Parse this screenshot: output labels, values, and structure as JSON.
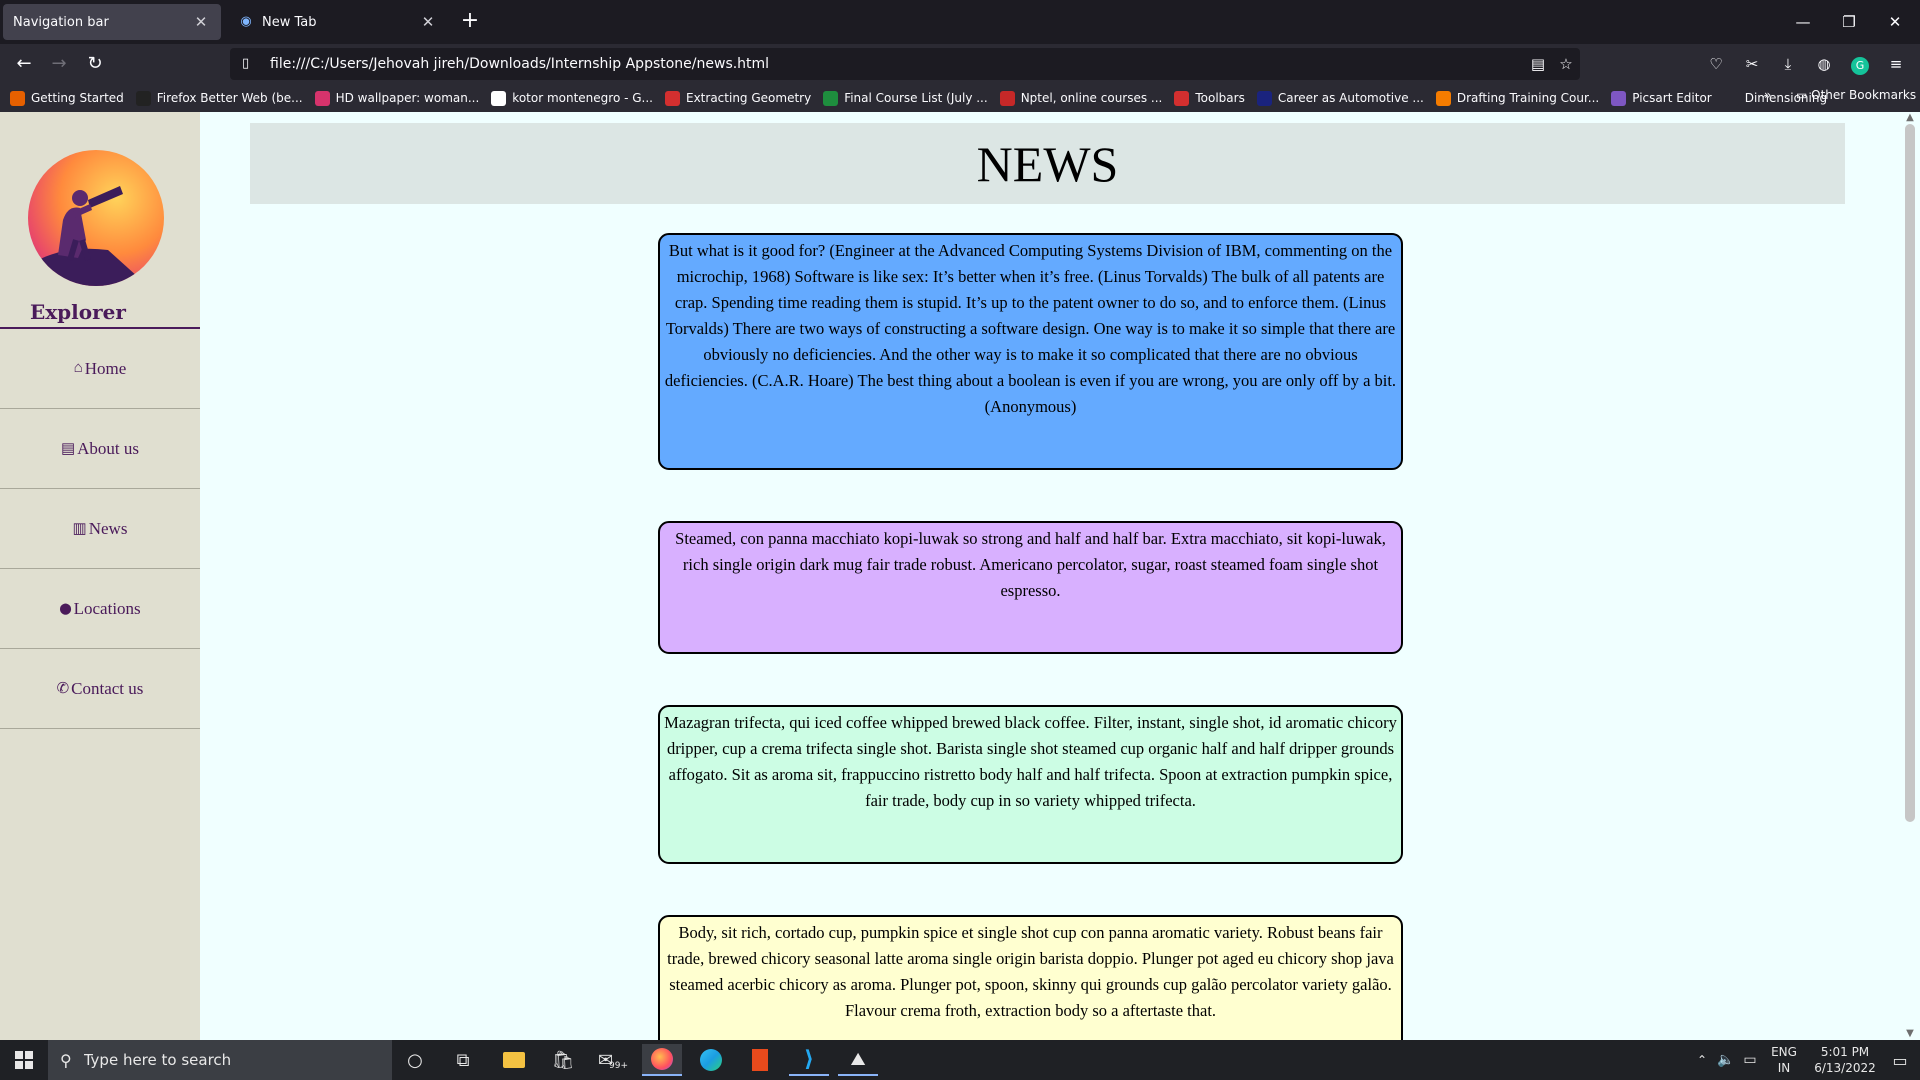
{
  "browser": {
    "tabs": [
      {
        "title": "Navigation bar",
        "active": true
      },
      {
        "title": "New Tab",
        "active": false
      }
    ],
    "url": "file:///C:/Users/Jehovah jireh/Downloads/Internship Appstone/news.html",
    "bookmarks": [
      {
        "label": "Getting Started",
        "icon": "firefox-icon",
        "color": "#e66000"
      },
      {
        "label": "Firefox Better Web (be...",
        "icon": "m-icon",
        "color": "#222222"
      },
      {
        "label": "HD wallpaper: woman...",
        "icon": "wallpaper-icon",
        "color": "#d6336c"
      },
      {
        "label": "kotor montenegro - G...",
        "icon": "google-icon",
        "color": "#ffffff"
      },
      {
        "label": "Extracting Geometry",
        "icon": "scribd-icon",
        "color": "#d32f2f"
      },
      {
        "label": "Final Course List (July ...",
        "icon": "sheets-icon",
        "color": "#1e8e3e"
      },
      {
        "label": "Nptel, online courses ...",
        "icon": "nptel-icon",
        "color": "#c62828"
      },
      {
        "label": "Toolbars",
        "icon": "scribd-icon",
        "color": "#d32f2f"
      },
      {
        "label": "Career as Automotive ...",
        "icon": "career-icon",
        "color": "#1a237e"
      },
      {
        "label": "Drafting Training Cour...",
        "icon": "drafting-icon",
        "color": "#f57c00"
      },
      {
        "label": "Picsart Editor",
        "icon": "picsart-icon",
        "color": "#7e57c2"
      },
      {
        "label": "Dimensioning",
        "icon": "globe-icon",
        "color": "#2b2a33"
      }
    ],
    "other_bookmarks": "Other Bookmarks"
  },
  "sidebar": {
    "brand": "Explorer",
    "items": [
      {
        "label": "Home",
        "icon": "home-icon",
        "glyph": "⌂"
      },
      {
        "label": "About us",
        "icon": "id-card-icon",
        "glyph": "▤"
      },
      {
        "label": "News",
        "icon": "newspaper-icon",
        "glyph": "▥"
      },
      {
        "label": "Locations",
        "icon": "map-pin-icon",
        "glyph": "⬤"
      },
      {
        "label": "Contact us",
        "icon": "phone-icon",
        "glyph": "✆"
      }
    ]
  },
  "main": {
    "title": "NEWS",
    "cards": [
      {
        "text": "But what is it good for? (Engineer at the Advanced Computing Systems Division of IBM, commenting on the microchip, 1968) Software is like sex: It’s better when it’s free. (Linus Torvalds) The bulk of all patents are crap. Spending time reading them is stupid. It’s up to the patent owner to do so, and to enforce them. (Linus Torvalds) There are two ways of constructing a software design. One way is to make it so simple that there are obviously no deficiencies. And the other way is to make it so complicated that there are no obvious deficiencies. (C.A.R. Hoare) The best thing about a boolean is even if you are wrong, you are only off by a bit. (Anonymous)",
        "color": "#64aaff"
      },
      {
        "text": "Steamed, con panna macchiato kopi-luwak so strong and half and half bar. Extra macchiato, sit kopi-luwak, rich single origin dark mug fair trade robust. Americano percolator, sugar, roast steamed foam single shot espresso.",
        "color": "#d8b0ff"
      },
      {
        "text": "Mazagran trifecta, qui iced coffee whipped brewed black coffee. Filter, instant, single shot, id aromatic chicory dripper, cup a crema trifecta single shot. Barista single shot steamed cup organic half and half dripper grounds affogato. Sit as aroma sit, frappuccino ristretto body half and half trifecta. Spoon at extraction pumpkin spice, fair trade, body cup in so variety whipped trifecta.",
        "color": "#ccfde4"
      },
      {
        "text": "Body, sit rich, cortado cup, pumpkin spice et single shot cup con panna aromatic variety. Robust beans fair trade, brewed chicory seasonal latte aroma single origin barista doppio. Plunger pot aged eu chicory shop java steamed acerbic chicory as aroma. Plunger pot, spoon, skinny qui grounds cup galão percolator variety galão. Flavour crema froth, extraction body so a aftertaste that.",
        "color": "#ffffd0"
      }
    ]
  },
  "taskbar": {
    "search_placeholder": "Type here to search",
    "mail_badge": "99+",
    "language": "ENG",
    "region": "IN",
    "time": "5:01 PM",
    "date": "6/13/2022"
  }
}
